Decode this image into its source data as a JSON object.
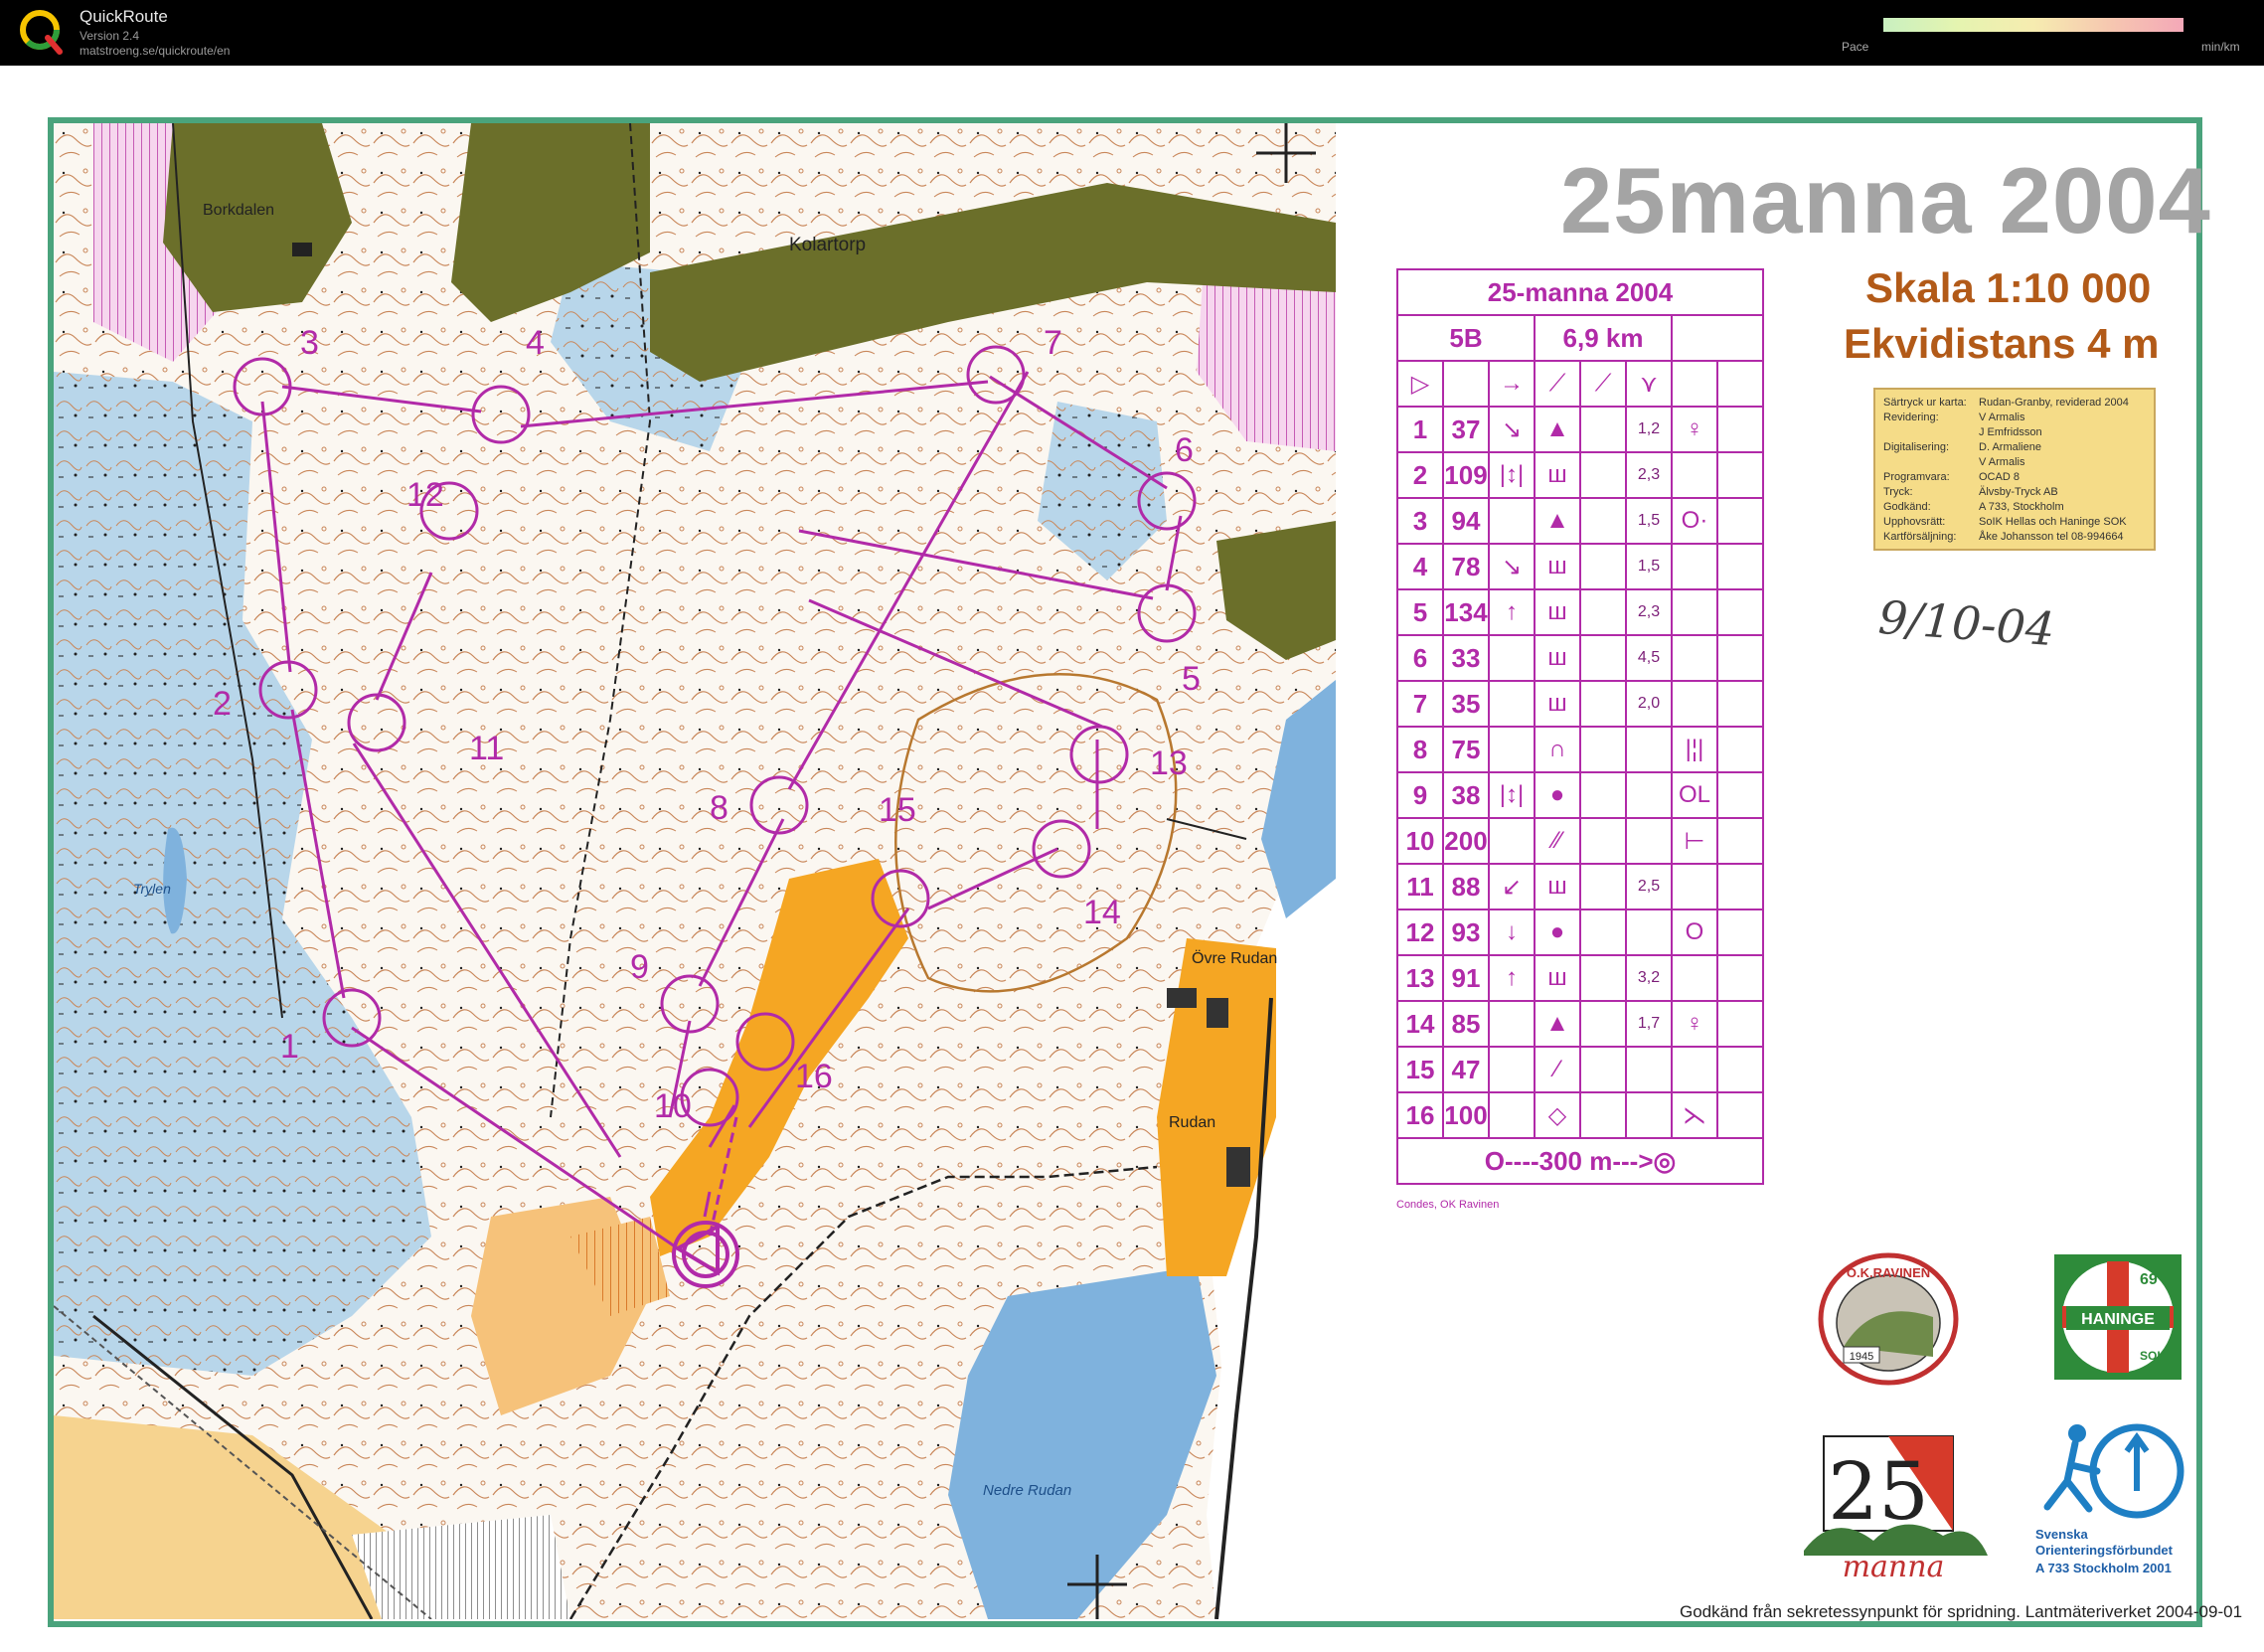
{
  "app": {
    "name": "QuickRoute",
    "version": "Version 2.4",
    "url": "matstroeng.se/quickroute/en",
    "pace_label": "Pace",
    "pace_unit": "min/km"
  },
  "map": {
    "title": "25manna 2004",
    "scale": "Skala 1:10 000",
    "contour": "Ekvidistans 4 m",
    "handwritten_date": "9/10-04",
    "credits": [
      {
        "key": "Särtryck ur karta:",
        "value": "Rudan-Granby, reviderad 2004"
      },
      {
        "key": "Revidering:",
        "value": "V Armalis"
      },
      {
        "key": "",
        "value": "J Emfridsson"
      },
      {
        "key": "Digitalisering:",
        "value": "D. Armaliene"
      },
      {
        "key": "",
        "value": "V Armalis"
      },
      {
        "key": "Programvara:",
        "value": "OCAD 8"
      },
      {
        "key": "Tryck:",
        "value": "Älvsby-Tryck AB"
      },
      {
        "key": "Godkänd:",
        "value": "A 733, Stockholm"
      },
      {
        "key": "Upphovsrätt:",
        "value": "SoIK Hellas och Haninge SOK"
      },
      {
        "key": "Kartförsäljning:",
        "value": "Åke Johansson tel 08-994664"
      }
    ],
    "place_names": {
      "kolartorp": "Kolartorp",
      "borkdalen": "Borkdalen",
      "trylen": "Trylen",
      "ovre_rudan": "Övre Rudan",
      "rudan": "Rudan",
      "nedre_rudan": "Nedre Rudan"
    },
    "controls": [
      {
        "label": "1"
      },
      {
        "label": "2"
      },
      {
        "label": "3"
      },
      {
        "label": "4"
      },
      {
        "label": "5"
      },
      {
        "label": "6"
      },
      {
        "label": "7"
      },
      {
        "label": "8"
      },
      {
        "label": "9"
      },
      {
        "label": "10"
      },
      {
        "label": "11"
      },
      {
        "label": "12"
      },
      {
        "label": "13"
      },
      {
        "label": "14"
      },
      {
        "label": "15"
      },
      {
        "label": "16"
      }
    ],
    "colors": {
      "course": "#b12aa8",
      "forest": "#ffffff",
      "open": "#f5a623",
      "water": "#7fb2dd",
      "green": "#6b6f2a",
      "frame": "#4aa37c"
    },
    "footer": "Godkänd från sekretessynpunkt för spridning. Lantmäteriverket 2004-09-01",
    "condes": "Condes, OK Ravinen"
  },
  "control_table": {
    "title": "25-manna 2004",
    "class": "5B",
    "length": "6,9 km",
    "rows": [
      {
        "n": "1",
        "code": "37",
        "a": "↘",
        "b": "▲",
        "dim": "1,2",
        "extra": "♀"
      },
      {
        "n": "2",
        "code": "109",
        "a": "|↕|",
        "b": "ш",
        "dim": "2,3",
        "extra": ""
      },
      {
        "n": "3",
        "code": "94",
        "a": "",
        "b": "▲",
        "dim": "1,5",
        "extra": "O·"
      },
      {
        "n": "4",
        "code": "78",
        "a": "↘",
        "b": "ш",
        "dim": "1,5",
        "extra": ""
      },
      {
        "n": "5",
        "code": "134",
        "a": "↑",
        "b": "ш",
        "dim": "2,3",
        "extra": ""
      },
      {
        "n": "6",
        "code": "33",
        "a": "",
        "b": "ш",
        "dim": "4,5",
        "extra": ""
      },
      {
        "n": "7",
        "code": "35",
        "a": "",
        "b": "ш",
        "dim": "2,0",
        "extra": ""
      },
      {
        "n": "8",
        "code": "75",
        "a": "",
        "b": "∩",
        "dim": "",
        "extra": "|¦|"
      },
      {
        "n": "9",
        "code": "38",
        "a": "|↕|",
        "b": "●",
        "dim": "",
        "extra": "OL"
      },
      {
        "n": "10",
        "code": "200",
        "a": "",
        "b": "⁄⁄",
        "dim": "",
        "extra": "⊢"
      },
      {
        "n": "11",
        "code": "88",
        "a": "↙",
        "b": "ш",
        "dim": "2,5",
        "extra": ""
      },
      {
        "n": "12",
        "code": "93",
        "a": "↓",
        "b": "●",
        "dim": "",
        "extra": "O"
      },
      {
        "n": "13",
        "code": "91",
        "a": "↑",
        "b": "ш",
        "dim": "3,2",
        "extra": ""
      },
      {
        "n": "14",
        "code": "85",
        "a": "",
        "b": "▲",
        "dim": "1,7",
        "extra": "♀"
      },
      {
        "n": "15",
        "code": "47",
        "a": "",
        "b": "⁄",
        "dim": "",
        "extra": ""
      },
      {
        "n": "16",
        "code": "100",
        "a": "",
        "b": "◇",
        "dim": "",
        "extra": "⋋"
      }
    ],
    "finish": "O----300 m--->◎"
  },
  "logos": {
    "ravinen": "O.K.RAVINEN",
    "ravinen_year": "1945",
    "haninge": "HANINGE",
    "haninge_69": "69",
    "haninge_sok": "SOK",
    "manna25": "25",
    "manna_word": "manna",
    "sof_line1": "Svenska",
    "sof_line2": "Orienteringsförbundet",
    "sof_line3": "A 733 Stockholm 2001"
  }
}
